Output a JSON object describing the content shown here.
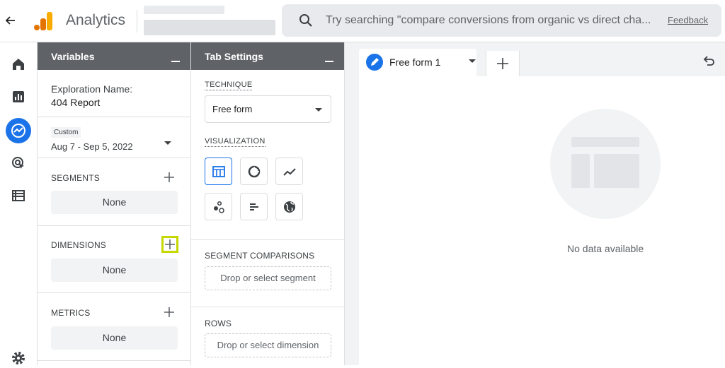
{
  "header": {
    "app_title": "Analytics",
    "search_placeholder": "Try searching \"compare conversions from organic vs direct cha...",
    "feedback_label": "Feedback"
  },
  "colors": {
    "accent": "#1a73e8",
    "panel_header": "#5f6368",
    "highlight": "#c6d800",
    "logo_orange": "#f9ab00",
    "logo_dark_orange": "#e37400"
  },
  "nav": [
    "home-icon",
    "reports-icon",
    "explore-icon",
    "advertising-icon",
    "configure-icon",
    "settings-icon"
  ],
  "variables": {
    "title": "Variables",
    "exploration_name_label": "Exploration Name:",
    "exploration_name": "404 Report",
    "date_chip": "Custom",
    "date_range": "Aug 7 - Sep 5, 2022",
    "segments_label": "SEGMENTS",
    "segments_value": "None",
    "dimensions_label": "DIMENSIONS",
    "dimensions_value": "None",
    "metrics_label": "METRICS",
    "metrics_value": "None"
  },
  "tab_settings": {
    "title": "Tab Settings",
    "technique_label": "TECHNIQUE",
    "technique_value": "Free form",
    "visualization_label": "VISUALIZATION",
    "visualizations": [
      "table-icon",
      "donut-icon",
      "line-icon",
      "scatter-icon",
      "bar-icon",
      "geo-icon"
    ],
    "selected_visualization": "table-icon",
    "segment_comparisons_label": "SEGMENT COMPARISONS",
    "segment_drop": "Drop or select segment",
    "rows_label": "ROWS",
    "rows_drop": "Drop or select dimension"
  },
  "canvas": {
    "tab_label": "Free form 1",
    "empty_message": "No data available"
  }
}
